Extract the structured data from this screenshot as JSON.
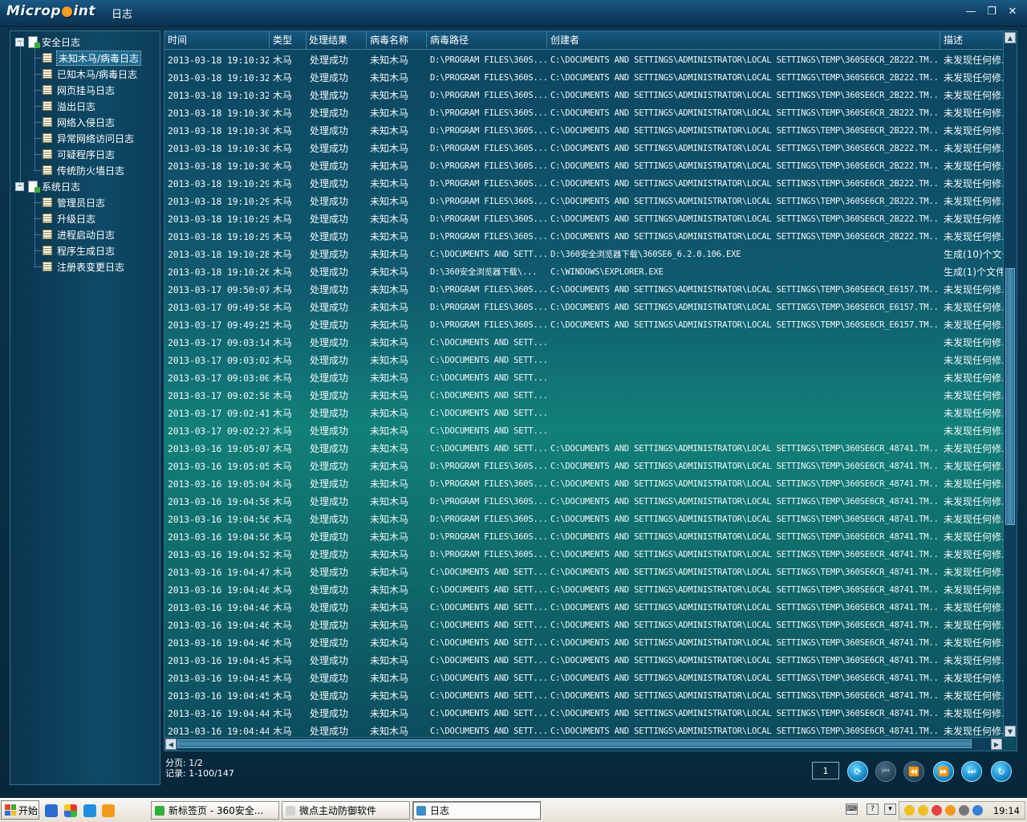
{
  "app": {
    "logo_prefix": "Microp",
    "logo_suffix": "int",
    "title": "日志"
  },
  "window_controls": {
    "minimize": "—",
    "restore": "❐",
    "close": "✕"
  },
  "tree": [
    {
      "label": "安全日志",
      "children": [
        "未知木马/病毒日志",
        "已知木马/病毒日志",
        "网页挂马日志",
        "溢出日志",
        "网络入侵日志",
        "异常网络访问日志",
        "可疑程序日志",
        "传统防火墙日志"
      ]
    },
    {
      "label": "系统日志",
      "children": [
        "管理员日志",
        "升级日志",
        "进程启动日志",
        "程序生成日志",
        "注册表变更日志"
      ]
    }
  ],
  "grid": {
    "columns": [
      "时间",
      "类型",
      "处理结果",
      "病毒名称",
      "病毒路径",
      "创建者",
      "描述"
    ],
    "rows": [
      [
        "2013-03-18 19:10:32",
        "木马",
        "处理成功",
        "未知木马",
        "D:\\PROGRAM FILES\\360S...",
        "C:\\DOCUMENTS AND SETTINGS\\ADMINISTRATOR\\LOCAL SETTINGS\\TEMP\\360SE6CR_2B222.TM...",
        "未发现任何修..."
      ],
      [
        "2013-03-18 19:10:32",
        "木马",
        "处理成功",
        "未知木马",
        "D:\\PROGRAM FILES\\360S...",
        "C:\\DOCUMENTS AND SETTINGS\\ADMINISTRATOR\\LOCAL SETTINGS\\TEMP\\360SE6CR_2B222.TM...",
        "未发现任何修..."
      ],
      [
        "2013-03-18 19:10:32",
        "木马",
        "处理成功",
        "未知木马",
        "D:\\PROGRAM FILES\\360S...",
        "C:\\DOCUMENTS AND SETTINGS\\ADMINISTRATOR\\LOCAL SETTINGS\\TEMP\\360SE6CR_2B222.TM...",
        "未发现任何修..."
      ],
      [
        "2013-03-18 19:10:30",
        "木马",
        "处理成功",
        "未知木马",
        "D:\\PROGRAM FILES\\360S...",
        "C:\\DOCUMENTS AND SETTINGS\\ADMINISTRATOR\\LOCAL SETTINGS\\TEMP\\360SE6CR_2B222.TM...",
        "未发现任何修..."
      ],
      [
        "2013-03-18 19:10:30",
        "木马",
        "处理成功",
        "未知木马",
        "D:\\PROGRAM FILES\\360S...",
        "C:\\DOCUMENTS AND SETTINGS\\ADMINISTRATOR\\LOCAL SETTINGS\\TEMP\\360SE6CR_2B222.TM...",
        "未发现任何修..."
      ],
      [
        "2013-03-18 19:10:30",
        "木马",
        "处理成功",
        "未知木马",
        "D:\\PROGRAM FILES\\360S...",
        "C:\\DOCUMENTS AND SETTINGS\\ADMINISTRATOR\\LOCAL SETTINGS\\TEMP\\360SE6CR_2B222.TM...",
        "未发现任何修..."
      ],
      [
        "2013-03-18 19:10:30",
        "木马",
        "处理成功",
        "未知木马",
        "D:\\PROGRAM FILES\\360S...",
        "C:\\DOCUMENTS AND SETTINGS\\ADMINISTRATOR\\LOCAL SETTINGS\\TEMP\\360SE6CR_2B222.TM...",
        "未发现任何修..."
      ],
      [
        "2013-03-18 19:10:29",
        "木马",
        "处理成功",
        "未知木马",
        "D:\\PROGRAM FILES\\360S...",
        "C:\\DOCUMENTS AND SETTINGS\\ADMINISTRATOR\\LOCAL SETTINGS\\TEMP\\360SE6CR_2B222.TM...",
        "未发现任何修..."
      ],
      [
        "2013-03-18 19:10:29",
        "木马",
        "处理成功",
        "未知木马",
        "D:\\PROGRAM FILES\\360S...",
        "C:\\DOCUMENTS AND SETTINGS\\ADMINISTRATOR\\LOCAL SETTINGS\\TEMP\\360SE6CR_2B222.TM...",
        "未发现任何修..."
      ],
      [
        "2013-03-18 19:10:29",
        "木马",
        "处理成功",
        "未知木马",
        "D:\\PROGRAM FILES\\360S...",
        "C:\\DOCUMENTS AND SETTINGS\\ADMINISTRATOR\\LOCAL SETTINGS\\TEMP\\360SE6CR_2B222.TM...",
        "未发现任何修..."
      ],
      [
        "2013-03-18 19:10:29",
        "木马",
        "处理成功",
        "未知木马",
        "D:\\PROGRAM FILES\\360S...",
        "C:\\DOCUMENTS AND SETTINGS\\ADMINISTRATOR\\LOCAL SETTINGS\\TEMP\\360SE6CR_2B222.TM...",
        "未发现任何修..."
      ],
      [
        "2013-03-18 19:10:28",
        "木马",
        "处理成功",
        "未知木马",
        "C:\\DOCUMENTS AND SETT...",
        "D:\\360安全浏览器下载\\360SE6_6.2.0.106.EXE",
        "生成(10)个文件..."
      ],
      [
        "2013-03-18 19:10:26",
        "木马",
        "处理成功",
        "未知木马",
        "D:\\360安全浏览器下载\\...",
        "C:\\WINDOWS\\EXPLORER.EXE",
        "生成(1)个文件..."
      ],
      [
        "2013-03-17 09:50:07",
        "木马",
        "处理成功",
        "未知木马",
        "D:\\PROGRAM FILES\\360S...",
        "C:\\DOCUMENTS AND SETTINGS\\ADMINISTRATOR\\LOCAL SETTINGS\\TEMP\\360SE6CR_E6157.TM...",
        "未发现任何修..."
      ],
      [
        "2013-03-17 09:49:58",
        "木马",
        "处理成功",
        "未知木马",
        "D:\\PROGRAM FILES\\360S...",
        "C:\\DOCUMENTS AND SETTINGS\\ADMINISTRATOR\\LOCAL SETTINGS\\TEMP\\360SE6CR_E6157.TM...",
        "未发现任何修..."
      ],
      [
        "2013-03-17 09:49:25",
        "木马",
        "处理成功",
        "未知木马",
        "D:\\PROGRAM FILES\\360S...",
        "C:\\DOCUMENTS AND SETTINGS\\ADMINISTRATOR\\LOCAL SETTINGS\\TEMP\\360SE6CR_E6157.TM...",
        "未发现任何修..."
      ],
      [
        "2013-03-17 09:03:14",
        "木马",
        "处理成功",
        "未知木马",
        "C:\\DOCUMENTS AND SETT...",
        "",
        "未发现任何修..."
      ],
      [
        "2013-03-17 09:03:02",
        "木马",
        "处理成功",
        "未知木马",
        "C:\\DOCUMENTS AND SETT...",
        "",
        "未发现任何修..."
      ],
      [
        "2013-03-17 09:03:00",
        "木马",
        "处理成功",
        "未知木马",
        "C:\\DOCUMENTS AND SETT...",
        "",
        "未发现任何修..."
      ],
      [
        "2013-03-17 09:02:58",
        "木马",
        "处理成功",
        "未知木马",
        "C:\\DOCUMENTS AND SETT...",
        "",
        "未发现任何修..."
      ],
      [
        "2013-03-17 09:02:41",
        "木马",
        "处理成功",
        "未知木马",
        "C:\\DOCUMENTS AND SETT...",
        "",
        "未发现任何修..."
      ],
      [
        "2013-03-17 09:02:27",
        "木马",
        "处理成功",
        "未知木马",
        "C:\\DOCUMENTS AND SETT...",
        "",
        "未发现任何修..."
      ],
      [
        "2013-03-16 19:05:07",
        "木马",
        "处理成功",
        "未知木马",
        "C:\\DOCUMENTS AND SETT...",
        "C:\\DOCUMENTS AND SETTINGS\\ADMINISTRATOR\\LOCAL SETTINGS\\TEMP\\360SE6CR_48741.TM...",
        "未发现任何修..."
      ],
      [
        "2013-03-16 19:05:05",
        "木马",
        "处理成功",
        "未知木马",
        "D:\\PROGRAM FILES\\360S...",
        "C:\\DOCUMENTS AND SETTINGS\\ADMINISTRATOR\\LOCAL SETTINGS\\TEMP\\360SE6CR_48741.TM...",
        "未发现任何修..."
      ],
      [
        "2013-03-16 19:05:04",
        "木马",
        "处理成功",
        "未知木马",
        "D:\\PROGRAM FILES\\360S...",
        "C:\\DOCUMENTS AND SETTINGS\\ADMINISTRATOR\\LOCAL SETTINGS\\TEMP\\360SE6CR_48741.TM...",
        "未发现任何修..."
      ],
      [
        "2013-03-16 19:04:58",
        "木马",
        "处理成功",
        "未知木马",
        "D:\\PROGRAM FILES\\360S...",
        "C:\\DOCUMENTS AND SETTINGS\\ADMINISTRATOR\\LOCAL SETTINGS\\TEMP\\360SE6CR_48741.TM...",
        "未发现任何修..."
      ],
      [
        "2013-03-16 19:04:56",
        "木马",
        "处理成功",
        "未知木马",
        "D:\\PROGRAM FILES\\360S...",
        "C:\\DOCUMENTS AND SETTINGS\\ADMINISTRATOR\\LOCAL SETTINGS\\TEMP\\360SE6CR_48741.TM...",
        "未发现任何修..."
      ],
      [
        "2013-03-16 19:04:56",
        "木马",
        "处理成功",
        "未知木马",
        "D:\\PROGRAM FILES\\360S...",
        "C:\\DOCUMENTS AND SETTINGS\\ADMINISTRATOR\\LOCAL SETTINGS\\TEMP\\360SE6CR_48741.TM...",
        "未发现任何修..."
      ],
      [
        "2013-03-16 19:04:52",
        "木马",
        "处理成功",
        "未知木马",
        "D:\\PROGRAM FILES\\360S...",
        "C:\\DOCUMENTS AND SETTINGS\\ADMINISTRATOR\\LOCAL SETTINGS\\TEMP\\360SE6CR_48741.TM...",
        "未发现任何修..."
      ],
      [
        "2013-03-16 19:04:47",
        "木马",
        "处理成功",
        "未知木马",
        "C:\\DOCUMENTS AND SETT...",
        "C:\\DOCUMENTS AND SETTINGS\\ADMINISTRATOR\\LOCAL SETTINGS\\TEMP\\360SE6CR_48741.TM...",
        "未发现任何修..."
      ],
      [
        "2013-03-16 19:04:46",
        "木马",
        "处理成功",
        "未知木马",
        "C:\\DOCUMENTS AND SETT...",
        "C:\\DOCUMENTS AND SETTINGS\\ADMINISTRATOR\\LOCAL SETTINGS\\TEMP\\360SE6CR_48741.TM...",
        "未发现任何修..."
      ],
      [
        "2013-03-16 19:04:46",
        "木马",
        "处理成功",
        "未知木马",
        "C:\\DOCUMENTS AND SETT...",
        "C:\\DOCUMENTS AND SETTINGS\\ADMINISTRATOR\\LOCAL SETTINGS\\TEMP\\360SE6CR_48741.TM...",
        "未发现任何修..."
      ],
      [
        "2013-03-16 19:04:46",
        "木马",
        "处理成功",
        "未知木马",
        "C:\\DOCUMENTS AND SETT...",
        "C:\\DOCUMENTS AND SETTINGS\\ADMINISTRATOR\\LOCAL SETTINGS\\TEMP\\360SE6CR_48741.TM...",
        "未发现任何修..."
      ],
      [
        "2013-03-16 19:04:46",
        "木马",
        "处理成功",
        "未知木马",
        "C:\\DOCUMENTS AND SETT...",
        "C:\\DOCUMENTS AND SETTINGS\\ADMINISTRATOR\\LOCAL SETTINGS\\TEMP\\360SE6CR_48741.TM...",
        "未发现任何修..."
      ],
      [
        "2013-03-16 19:04:45",
        "木马",
        "处理成功",
        "未知木马",
        "C:\\DOCUMENTS AND SETT...",
        "C:\\DOCUMENTS AND SETTINGS\\ADMINISTRATOR\\LOCAL SETTINGS\\TEMP\\360SE6CR_48741.TM...",
        "未发现任何修..."
      ],
      [
        "2013-03-16 19:04:45",
        "木马",
        "处理成功",
        "未知木马",
        "C:\\DOCUMENTS AND SETT...",
        "C:\\DOCUMENTS AND SETTINGS\\ADMINISTRATOR\\LOCAL SETTINGS\\TEMP\\360SE6CR_48741.TM...",
        "未发现任何修..."
      ],
      [
        "2013-03-16 19:04:45",
        "木马",
        "处理成功",
        "未知木马",
        "C:\\DOCUMENTS AND SETT...",
        "C:\\DOCUMENTS AND SETTINGS\\ADMINISTRATOR\\LOCAL SETTINGS\\TEMP\\360SE6CR_48741.TM...",
        "未发现任何修..."
      ],
      [
        "2013-03-16 19:04:44",
        "木马",
        "处理成功",
        "未知木马",
        "C:\\DOCUMENTS AND SETT...",
        "C:\\DOCUMENTS AND SETTINGS\\ADMINISTRATOR\\LOCAL SETTINGS\\TEMP\\360SE6CR_48741.TM...",
        "未发现任何修..."
      ],
      [
        "2013-03-16 19:04:44",
        "木马",
        "处理成功",
        "未知木马",
        "C:\\DOCUMENTS AND SETT...",
        "C:\\DOCUMENTS AND SETTINGS\\ADMINISTRATOR\\LOCAL SETTINGS\\TEMP\\360SE6CR_48741.TM...",
        "未发现任何修..."
      ]
    ]
  },
  "pagination": {
    "page_label": "分页: 1/2",
    "records_label": "记录: 1-100/147",
    "page_input": "1"
  },
  "taskbar": {
    "start_label": "开始",
    "tasks": [
      "新标签页 - 360安全...",
      "微点主动防御软件",
      "日志"
    ],
    "clock": "19:14"
  }
}
